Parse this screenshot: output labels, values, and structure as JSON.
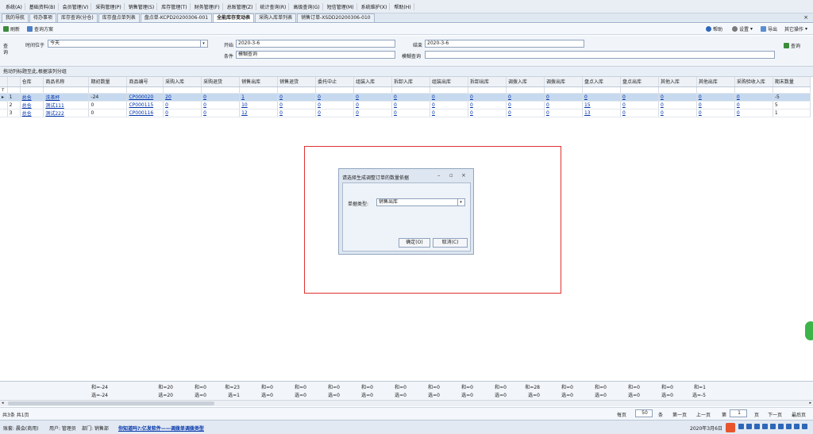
{
  "menu": [
    "系统(A)",
    "基础资料(B)",
    "会员管理(V)",
    "采购管理(P)",
    "销售管理(S)",
    "库存管理(T)",
    "财务管理(F)",
    "总账管理(Z)",
    "统计查询(R)",
    "高级查询(G)",
    "短信管理(M)",
    "系统维护(X)",
    "帮助(H)"
  ],
  "tabs": [
    "我的导航",
    "待办事项",
    "库存查询(分仓)",
    "库存盘点单列表",
    "盘点单-KCPD20200306-001",
    "全能库存变动表",
    "采购入库单列表",
    "销售订单-XSDD20200306-010"
  ],
  "tab_close": "×",
  "toolbar": {
    "refresh": "刷新",
    "scheme": "查询方案",
    "help": "帮助",
    "settings": "设置",
    "export": "导出",
    "other": "其它操作"
  },
  "query": {
    "side_label": "查询",
    "time_label": "时间位于",
    "time_value": "今天",
    "start_label": "开始",
    "start_value": "2020-3-6",
    "end_label": "结束",
    "end_value": "2020-3-6",
    "cond_label": "条件",
    "cond_value": "模糊查询",
    "fuzzy_label": "模糊查询",
    "fuzzy_value": "",
    "query_btn": "查询"
  },
  "group_hint": "拖动列标题至此,根据该列分组",
  "grid": {
    "columns": [
      "",
      "",
      "仓库",
      "商品名称",
      "期初数量",
      "商品编号",
      "采购入库",
      "采购退货",
      "销售出库",
      "销售退货",
      "委托中止",
      "组装入库",
      "拆卸入库",
      "组装出库",
      "拆卸出库",
      "调拨入库",
      "调拨出库",
      "盘点入库",
      "盘点出库",
      "其他入库",
      "其他出库",
      "采购验收入库",
      "期末数量"
    ],
    "rows": [
      {
        "marker": "▸",
        "no": "1",
        "warehouse": "总仓",
        "name": "洗茶杯",
        "opening": "-24",
        "code": "CP000020",
        "vals": [
          "20",
          "0",
          "1",
          "0",
          "0",
          "0",
          "0",
          "0",
          "0",
          "0",
          "0",
          "0",
          "0",
          "0",
          "0",
          "0"
        ],
        "closing": "-5"
      },
      {
        "marker": "",
        "no": "2",
        "warehouse": "总仓",
        "name": "测试111",
        "opening": "0",
        "code": "CP000115",
        "vals": [
          "0",
          "0",
          "10",
          "0",
          "0",
          "0",
          "0",
          "0",
          "0",
          "0",
          "0",
          "15",
          "0",
          "0",
          "0",
          "0"
        ],
        "closing": "5"
      },
      {
        "marker": "",
        "no": "3",
        "warehouse": "总仓",
        "name": "测试222",
        "opening": "0",
        "code": "CP000116",
        "vals": [
          "0",
          "0",
          "12",
          "0",
          "0",
          "0",
          "0",
          "0",
          "0",
          "0",
          "0",
          "13",
          "0",
          "0",
          "0",
          "0"
        ],
        "closing": "1"
      }
    ]
  },
  "totals": {
    "sum": [
      "和=-24",
      "和=20",
      "和=0",
      "和=23",
      "和=0",
      "和=0",
      "和=0",
      "和=0",
      "和=0",
      "和=0",
      "和=0",
      "和=0",
      "和=28",
      "和=0",
      "和=0",
      "和=0",
      "和=0",
      "和=1"
    ],
    "sel": [
      "选=-24",
      "选=20",
      "选=0",
      "选=1",
      "选=0",
      "选=0",
      "选=0",
      "选=0",
      "选=0",
      "选=0",
      "选=0",
      "选=0",
      "选=0",
      "选=0",
      "选=0",
      "选=0",
      "选=0",
      "选=-5"
    ]
  },
  "pager": {
    "count": "共3条 共1页",
    "per_page_label": "每页",
    "per_page_value": "50",
    "unit": "条",
    "first": "第一页",
    "prev": "上一页",
    "page_prefix": "第",
    "page_value": "1",
    "page_suffix": "页",
    "next": "下一页",
    "last": "最后页"
  },
  "status": {
    "account": "账套: 晨会(商用)",
    "user": "用户: 管理员",
    "dept": "部门: 销售部",
    "promo": "你知道吗?:亿发软件——调拨单调拨类型",
    "date": "2020年3月6日"
  },
  "dialog": {
    "title": "请选择生成调整订单的数量依据",
    "type_label": "单据类型:",
    "type_value": "销售出库",
    "ok": "确定(O)",
    "cancel": "取消(C)"
  },
  "colors": {
    "highlight_box": "#e03030",
    "selected_row": "#c6d9ef",
    "link": "#0033aa"
  }
}
